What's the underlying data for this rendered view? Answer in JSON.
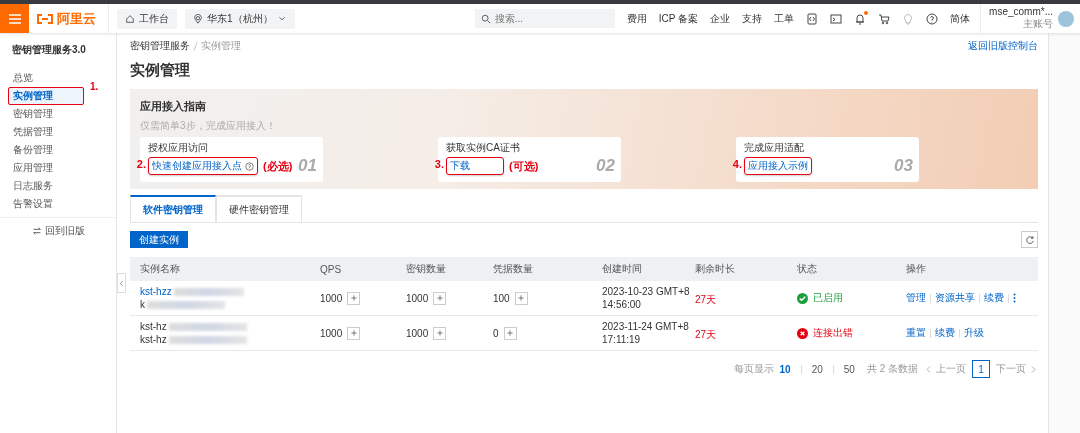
{
  "topbar": {
    "brand": "阿里云",
    "workbench": "工作台",
    "region": "华东1（杭州）",
    "search": {
      "placeholder": "搜索..."
    },
    "nav": [
      "费用",
      "ICP 备案",
      "企业",
      "支持",
      "工单"
    ],
    "notification_dot": true,
    "language": "简体",
    "user": {
      "name": "mse_comm*...",
      "role": "主账号"
    }
  },
  "sidebar": {
    "title": "密钥管理服务3.0",
    "items": [
      {
        "label": "总览",
        "selected": false
      },
      {
        "label": "实例管理",
        "selected": true,
        "marker": "1."
      },
      {
        "label": "密钥管理",
        "selected": false
      },
      {
        "label": "凭据管理",
        "selected": false
      },
      {
        "label": "备份管理",
        "selected": false
      },
      {
        "label": "应用管理",
        "selected": false
      },
      {
        "label": "日志服务",
        "selected": false
      },
      {
        "label": "告警设置",
        "selected": false
      }
    ],
    "footer": "回到旧版"
  },
  "breadcrumb": [
    "密钥管理服务",
    "实例管理"
  ],
  "back_link": "返回旧版控制台",
  "page_title": "实例管理",
  "guide": {
    "title": "应用接入指南",
    "subtitle": "仅需简单3步，完成应用接入！",
    "steps": [
      {
        "title": "授权应用访问",
        "link": "快速创建应用接入点",
        "help": true,
        "marker": "2.",
        "note": "(必选)",
        "number": "01"
      },
      {
        "title": "获取实例CA证书",
        "link": "下载",
        "help": false,
        "marker": "3.",
        "note": "(可选)",
        "number": "02"
      },
      {
        "title": "完成应用适配",
        "link": "应用接入示例",
        "help": false,
        "marker": "4.",
        "number": "03"
      }
    ]
  },
  "tabs": [
    {
      "label": "软件密钥管理",
      "selected": true
    },
    {
      "label": "硬件密钥管理",
      "selected": false
    }
  ],
  "create_button": "创建实例",
  "table": {
    "columns": [
      "实例名称",
      "QPS",
      "密钥数量",
      "凭据数量",
      "创建时间",
      "剩余时长",
      "状态",
      "操作"
    ],
    "rows": [
      {
        "name_lines": [
          {
            "text": "kst-hzz",
            "link": true
          },
          {
            "text": "k",
            "link": false
          }
        ],
        "qps": "1000",
        "keys": "1000",
        "secrets": "100",
        "created": [
          "2023-10-23 GMT+8",
          "14:56:00"
        ],
        "remaining": "27天",
        "status": {
          "kind": "ok",
          "label": "已启用"
        },
        "actions": [
          "管理",
          "资源共享",
          "续费"
        ],
        "more": true
      },
      {
        "name_lines": [
          {
            "text": "kst-hz",
            "link": false
          },
          {
            "text": "kst-hz",
            "link": false
          }
        ],
        "qps": "1000",
        "keys": "1000",
        "secrets": "0",
        "created": [
          "2023-11-24 GMT+8",
          "17:11:19"
        ],
        "remaining": "27天",
        "status": {
          "kind": "error",
          "label": "连接出错"
        },
        "actions": [
          "重置",
          "续费",
          "升级"
        ],
        "more": false
      }
    ]
  },
  "pagination": {
    "per_page_label": "每页显示",
    "sizes": [
      {
        "label": "10",
        "selected": true
      },
      {
        "label": "20",
        "selected": false
      },
      {
        "label": "50",
        "selected": false
      }
    ],
    "total": "共 2 条数据",
    "prev": "上一页",
    "pages": [
      {
        "label": "1",
        "selected": true
      }
    ],
    "next": "下一页"
  }
}
